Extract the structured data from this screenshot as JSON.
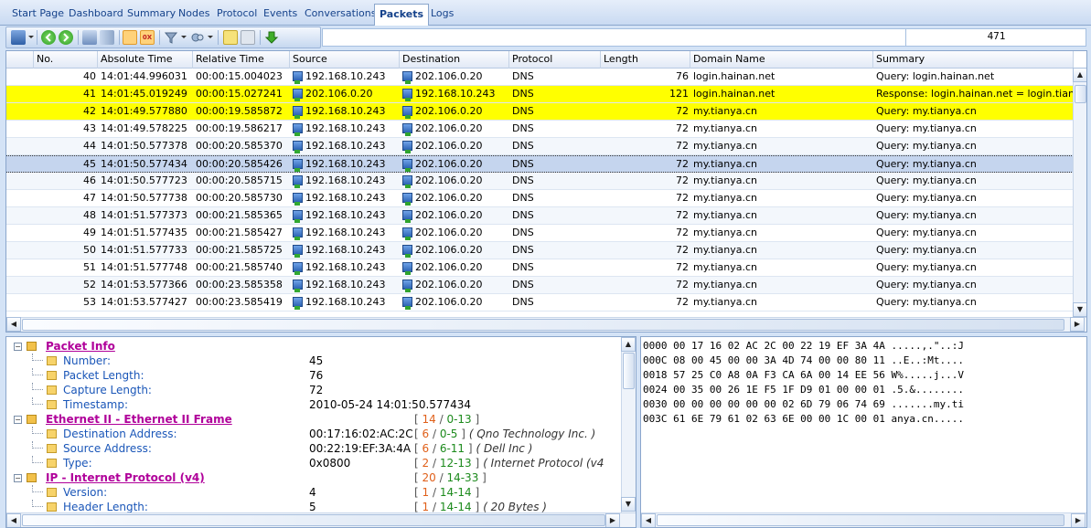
{
  "tabs": [
    "Start Page",
    "Dashboard",
    "Summary",
    "Nodes",
    "Protocol",
    "Events",
    "Conversations",
    "Packets",
    "Logs"
  ],
  "active_tab": "Packets",
  "toolbar": {
    "packet_count": "471"
  },
  "columns": [
    "No.",
    "Absolute Time",
    "Relative Time",
    "Source",
    "Destination",
    "Protocol",
    "Length",
    "Domain Name",
    "Summary"
  ],
  "rows": [
    {
      "no": "40",
      "abs": "14:01:44.996031",
      "rel": "00:00:15.004023",
      "src": "192.168.10.243",
      "dst": "202.106.0.20",
      "proto": "DNS",
      "len": "76",
      "domain": "login.hainan.net",
      "summary": "Query: login.hainan.net",
      "style": "normal"
    },
    {
      "no": "41",
      "abs": "14:01:45.019249",
      "rel": "00:00:15.027241",
      "src": "202.106.0.20",
      "dst": "192.168.10.243",
      "proto": "DNS",
      "len": "121",
      "domain": "login.hainan.net",
      "summary": "Response: login.hainan.net = login.tianya.cn",
      "style": "yellow"
    },
    {
      "no": "42",
      "abs": "14:01:49.577880",
      "rel": "00:00:19.585872",
      "src": "192.168.10.243",
      "dst": "202.106.0.20",
      "proto": "DNS",
      "len": "72",
      "domain": "my.tianya.cn",
      "summary": "Query: my.tianya.cn",
      "style": "yellow"
    },
    {
      "no": "43",
      "abs": "14:01:49.578225",
      "rel": "00:00:19.586217",
      "src": "192.168.10.243",
      "dst": "202.106.0.20",
      "proto": "DNS",
      "len": "72",
      "domain": "my.tianya.cn",
      "summary": "Query: my.tianya.cn",
      "style": "normal"
    },
    {
      "no": "44",
      "abs": "14:01:50.577378",
      "rel": "00:00:20.585370",
      "src": "192.168.10.243",
      "dst": "202.106.0.20",
      "proto": "DNS",
      "len": "72",
      "domain": "my.tianya.cn",
      "summary": "Query: my.tianya.cn",
      "style": "alt"
    },
    {
      "no": "45",
      "abs": "14:01:50.577434",
      "rel": "00:00:20.585426",
      "src": "192.168.10.243",
      "dst": "202.106.0.20",
      "proto": "DNS",
      "len": "72",
      "domain": "my.tianya.cn",
      "summary": "Query: my.tianya.cn",
      "style": "sel"
    },
    {
      "no": "46",
      "abs": "14:01:50.577723",
      "rel": "00:00:20.585715",
      "src": "192.168.10.243",
      "dst": "202.106.0.20",
      "proto": "DNS",
      "len": "72",
      "domain": "my.tianya.cn",
      "summary": "Query: my.tianya.cn",
      "style": "alt"
    },
    {
      "no": "47",
      "abs": "14:01:50.577738",
      "rel": "00:00:20.585730",
      "src": "192.168.10.243",
      "dst": "202.106.0.20",
      "proto": "DNS",
      "len": "72",
      "domain": "my.tianya.cn",
      "summary": "Query: my.tianya.cn",
      "style": "normal"
    },
    {
      "no": "48",
      "abs": "14:01:51.577373",
      "rel": "00:00:21.585365",
      "src": "192.168.10.243",
      "dst": "202.106.0.20",
      "proto": "DNS",
      "len": "72",
      "domain": "my.tianya.cn",
      "summary": "Query: my.tianya.cn",
      "style": "alt"
    },
    {
      "no": "49",
      "abs": "14:01:51.577435",
      "rel": "00:00:21.585427",
      "src": "192.168.10.243",
      "dst": "202.106.0.20",
      "proto": "DNS",
      "len": "72",
      "domain": "my.tianya.cn",
      "summary": "Query: my.tianya.cn",
      "style": "normal"
    },
    {
      "no": "50",
      "abs": "14:01:51.577733",
      "rel": "00:00:21.585725",
      "src": "192.168.10.243",
      "dst": "202.106.0.20",
      "proto": "DNS",
      "len": "72",
      "domain": "my.tianya.cn",
      "summary": "Query: my.tianya.cn",
      "style": "alt"
    },
    {
      "no": "51",
      "abs": "14:01:51.577748",
      "rel": "00:00:21.585740",
      "src": "192.168.10.243",
      "dst": "202.106.0.20",
      "proto": "DNS",
      "len": "72",
      "domain": "my.tianya.cn",
      "summary": "Query: my.tianya.cn",
      "style": "normal"
    },
    {
      "no": "52",
      "abs": "14:01:53.577366",
      "rel": "00:00:23.585358",
      "src": "192.168.10.243",
      "dst": "202.106.0.20",
      "proto": "DNS",
      "len": "72",
      "domain": "my.tianya.cn",
      "summary": "Query: my.tianya.cn",
      "style": "alt"
    },
    {
      "no": "53",
      "abs": "14:01:53.577427",
      "rel": "00:00:23.585419",
      "src": "192.168.10.243",
      "dst": "202.106.0.20",
      "proto": "DNS",
      "len": "72",
      "domain": "my.tianya.cn",
      "summary": "Query: my.tianya.cn",
      "style": "normal"
    }
  ],
  "tree": [
    {
      "kind": "head",
      "text": "Packet Info",
      "level": 0
    },
    {
      "kind": "field",
      "label": "Number:",
      "value": "45",
      "level": 1
    },
    {
      "kind": "field",
      "label": "Packet Length:",
      "value": "76",
      "level": 1
    },
    {
      "kind": "field",
      "label": "Capture Length:",
      "value": "72",
      "level": 1
    },
    {
      "kind": "field",
      "label": "Timestamp:",
      "value": "2010-05-24 14:01:50.577434",
      "level": 1
    },
    {
      "kind": "head",
      "text": "Ethernet II - Ethernet II Frame",
      "level": 0,
      "b1": "14",
      "b2": "0-13"
    },
    {
      "kind": "field",
      "label": "Destination Address:",
      "value": "00:17:16:02:AC:2C",
      "level": 1,
      "b1": "6",
      "b2": "0-5",
      "note": "( Qno Technology Inc. )"
    },
    {
      "kind": "field",
      "label": "Source Address:",
      "value": "00:22:19:EF:3A:4A",
      "level": 1,
      "b1": "6",
      "b2": "6-11",
      "note": "( Dell Inc )"
    },
    {
      "kind": "field",
      "label": "Type:",
      "value": "0x0800",
      "level": 1,
      "b1": "2",
      "b2": "12-13",
      "note": "( Internet Protocol (v4"
    },
    {
      "kind": "head",
      "text": "IP - Internet Protocol (v4)",
      "level": 0,
      "b1": "20",
      "b2": "14-33"
    },
    {
      "kind": "field",
      "label": "Version:",
      "value": "4",
      "level": 1,
      "b1": "1",
      "b2": "14-14"
    },
    {
      "kind": "field",
      "label": "Header Length:",
      "value": "5",
      "level": 1,
      "b1": "1",
      "b2": "14-14",
      "note": "( 20 Bytes )"
    }
  ],
  "hex": [
    "0000 00 17 16 02 AC 2C 00 22 19 EF 3A 4A .....,.\"..:J",
    "000C 08 00 45 00 00 3A 4D 74 00 00 80 11 ..E..:Mt....",
    "0018 57 25 C0 A8 0A F3 CA 6A 00 14 EE 56 W%.....j...V",
    "0024 00 35 00 26 1E F5 1F D9 01 00 00 01 .5.&........",
    "0030 00 00 00 00 00 00 02 6D 79 06 74 69 .......my.ti",
    "003C 61 6E 79 61 02 63 6E 00 00 1C 00 01 anya.cn....."
  ],
  "colors": {
    "highlight": "#ffff00",
    "selected": "#c5d5ee",
    "tree_header": "#b0009a",
    "tree_label": "#1a56b8"
  }
}
